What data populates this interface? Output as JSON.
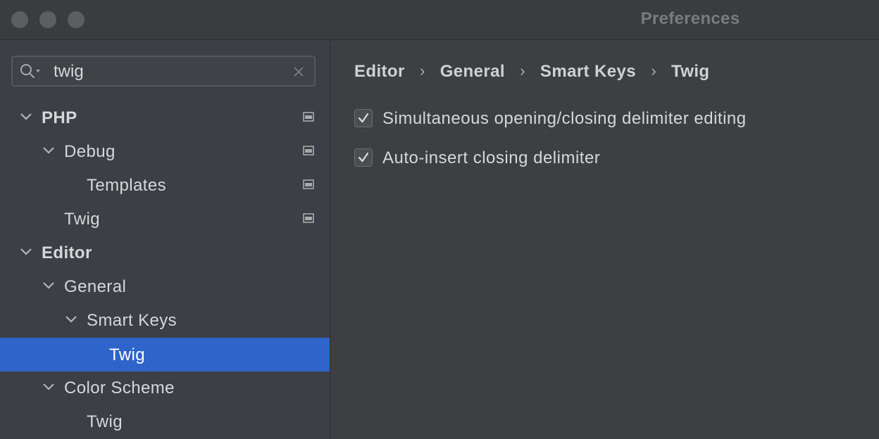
{
  "window": {
    "title": "Preferences"
  },
  "search": {
    "value": "twig"
  },
  "tree": [
    {
      "label": "PHP"
    },
    {
      "label": "Debug"
    },
    {
      "label": "Templates"
    },
    {
      "label": "Twig"
    },
    {
      "label": "Editor"
    },
    {
      "label": "General"
    },
    {
      "label": "Smart Keys"
    },
    {
      "label": "Twig"
    },
    {
      "label": "Color Scheme"
    },
    {
      "label": "Twig"
    }
  ],
  "breadcrumb": [
    "Editor",
    "General",
    "Smart Keys",
    "Twig"
  ],
  "breadcrumb_separator": "›",
  "options": [
    {
      "label": "Simultaneous opening/closing delimiter editing",
      "checked": true
    },
    {
      "label": "Auto-insert closing delimiter",
      "checked": true
    }
  ],
  "colors": {
    "selection": "#2f65ca",
    "sidebar_bg": "#3c3f45",
    "content_bg": "#3e3f42"
  }
}
